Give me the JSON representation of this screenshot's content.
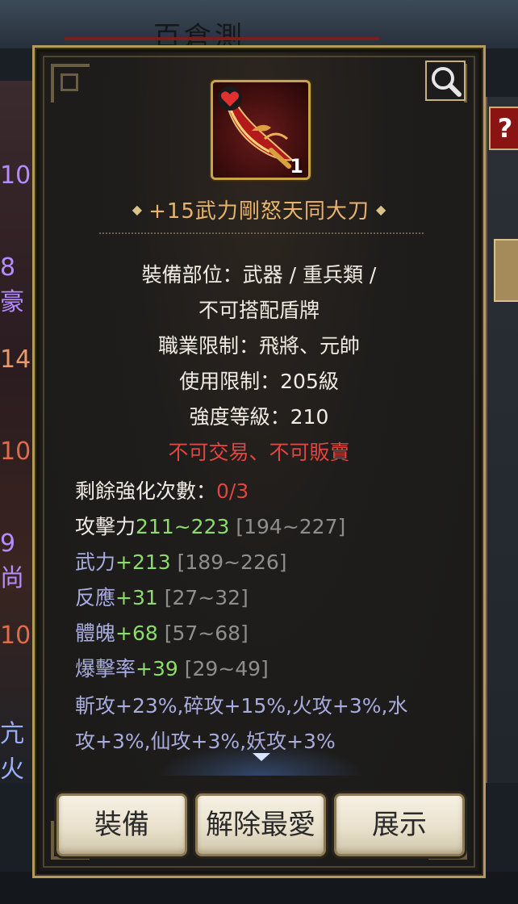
{
  "background": {
    "title": "百倉測",
    "left_numbers": [
      "10",
      "8豪",
      "14",
      "10",
      "9尚",
      "10",
      "亢火"
    ],
    "help_label": "?"
  },
  "item": {
    "name": "+15武力剛怒天同大刀",
    "count": "1",
    "icon": "heart-icon",
    "zoom_icon": "magnifier-icon"
  },
  "info": {
    "slot_line1": "裝備部位：武器 / 重兵類 /",
    "slot_line2": "不可搭配盾牌",
    "class_limit": "職業限制：飛將、元帥",
    "level_limit": "使用限制：205級",
    "strength_level": "強度等級：210",
    "trade_warning": "不可交易、不可販賣"
  },
  "stats": {
    "refine": {
      "label": "剩餘強化次數：",
      "value": "0/3"
    },
    "attack": {
      "label": "攻擊力",
      "value": "211~223",
      "range": "[194~227]"
    },
    "rows": [
      {
        "label": "武力",
        "value": "+213",
        "range": "[189~226]"
      },
      {
        "label": "反應",
        "value": "+31",
        "range": "[27~32]"
      },
      {
        "label": "體魄",
        "value": "+68",
        "range": "[57~68]"
      },
      {
        "label": "爆擊率",
        "value": "+39",
        "range": "[29~49]"
      }
    ],
    "element_line1": "斬攻+23%,碎攻+15%,火攻+3%,水",
    "element_line2": "攻+3%,仙攻+3%,妖攻+3%"
  },
  "buttons": {
    "equip": "裝備",
    "unfavorite": "解除最愛",
    "show": "展示"
  },
  "colors": {
    "gold_border": "#b59a5e",
    "name_orange": "#e7b46d",
    "warning_red": "#e0453f",
    "stat_green": "#8ddb6a",
    "stat_blue": "#a8acdd"
  }
}
